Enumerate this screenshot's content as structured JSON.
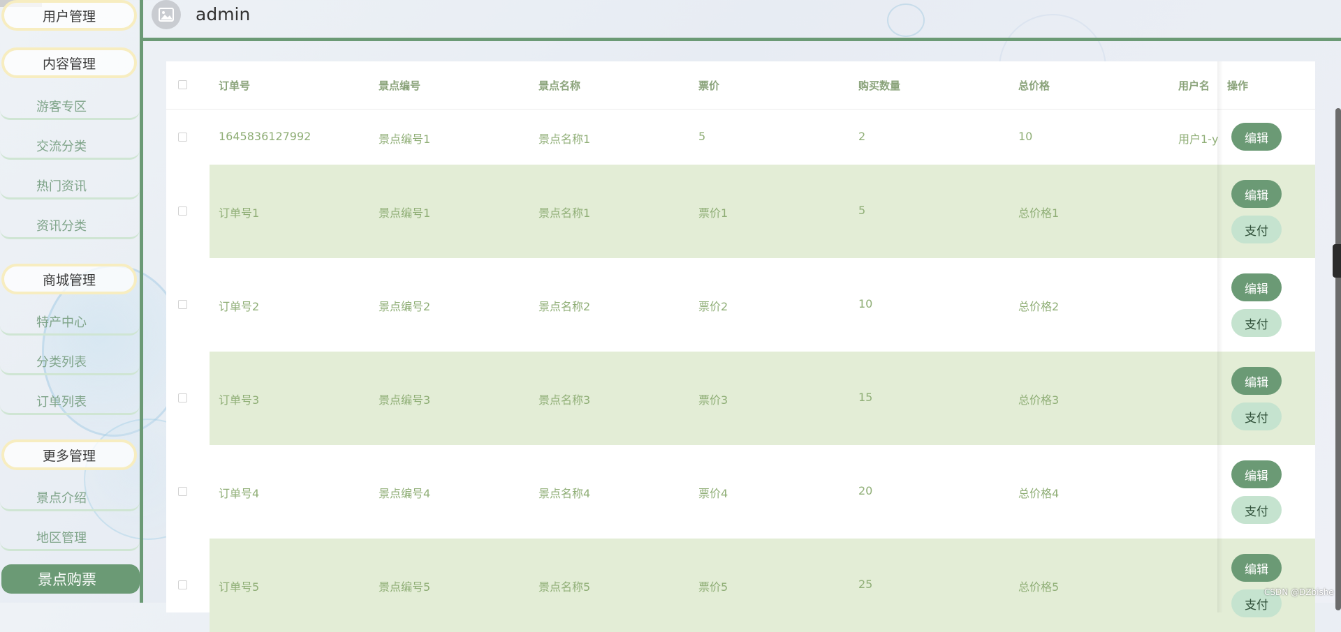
{
  "sidebar": {
    "groups": [
      {
        "label": "用户管理",
        "items": []
      },
      {
        "label": "内容管理",
        "items": [
          "游客专区",
          "交流分类",
          "热门资讯",
          "资讯分类"
        ]
      },
      {
        "label": "商城管理",
        "items": [
          "特产中心",
          "分类列表",
          "订单列表"
        ]
      },
      {
        "label": "更多管理",
        "items": [
          "景点介绍",
          "地区管理",
          "景点购票"
        ]
      }
    ],
    "active_item": "景点购票"
  },
  "header": {
    "username": "admin",
    "avatar_icon": "image-placeholder-icon"
  },
  "table": {
    "columns": [
      "订单号",
      "景点编号",
      "景点名称",
      "票价",
      "购买数量",
      "总价格",
      "用户名",
      "操作"
    ],
    "rows": [
      {
        "order_no": "1645836127992",
        "spot_no": "景点编号1",
        "spot_name": "景点名称1",
        "price": "5",
        "quantity": "2",
        "total": "10",
        "username": "用户1-y",
        "actions": [
          "编辑"
        ]
      },
      {
        "order_no": "订单号1",
        "spot_no": "景点编号1",
        "spot_name": "景点名称1",
        "price": "票价1",
        "quantity": "5",
        "total": "总价格1",
        "username": "",
        "actions": [
          "编辑",
          "支付"
        ]
      },
      {
        "order_no": "订单号2",
        "spot_no": "景点编号2",
        "spot_name": "景点名称2",
        "price": "票价2",
        "quantity": "10",
        "total": "总价格2",
        "username": "",
        "actions": [
          "编辑",
          "支付"
        ]
      },
      {
        "order_no": "订单号3",
        "spot_no": "景点编号3",
        "spot_name": "景点名称3",
        "price": "票价3",
        "quantity": "15",
        "total": "总价格3",
        "username": "",
        "actions": [
          "编辑",
          "支付"
        ]
      },
      {
        "order_no": "订单号4",
        "spot_no": "景点编号4",
        "spot_name": "景点名称4",
        "price": "票价4",
        "quantity": "20",
        "total": "总价格4",
        "username": "",
        "actions": [
          "编辑",
          "支付"
        ]
      },
      {
        "order_no": "订单号5",
        "spot_no": "景点编号5",
        "spot_name": "景点名称5",
        "price": "票价5",
        "quantity": "25",
        "total": "总价格5",
        "username": "",
        "actions": [
          "编辑",
          "支付"
        ]
      }
    ]
  },
  "watermark": "CSDN @DZbishe",
  "colors": {
    "primary": "#6b9a75",
    "stripe": "#e3edd6",
    "pay_button": "#c5e3cf",
    "header_text": "#8aa37a",
    "cell_text": "#8fae76"
  }
}
